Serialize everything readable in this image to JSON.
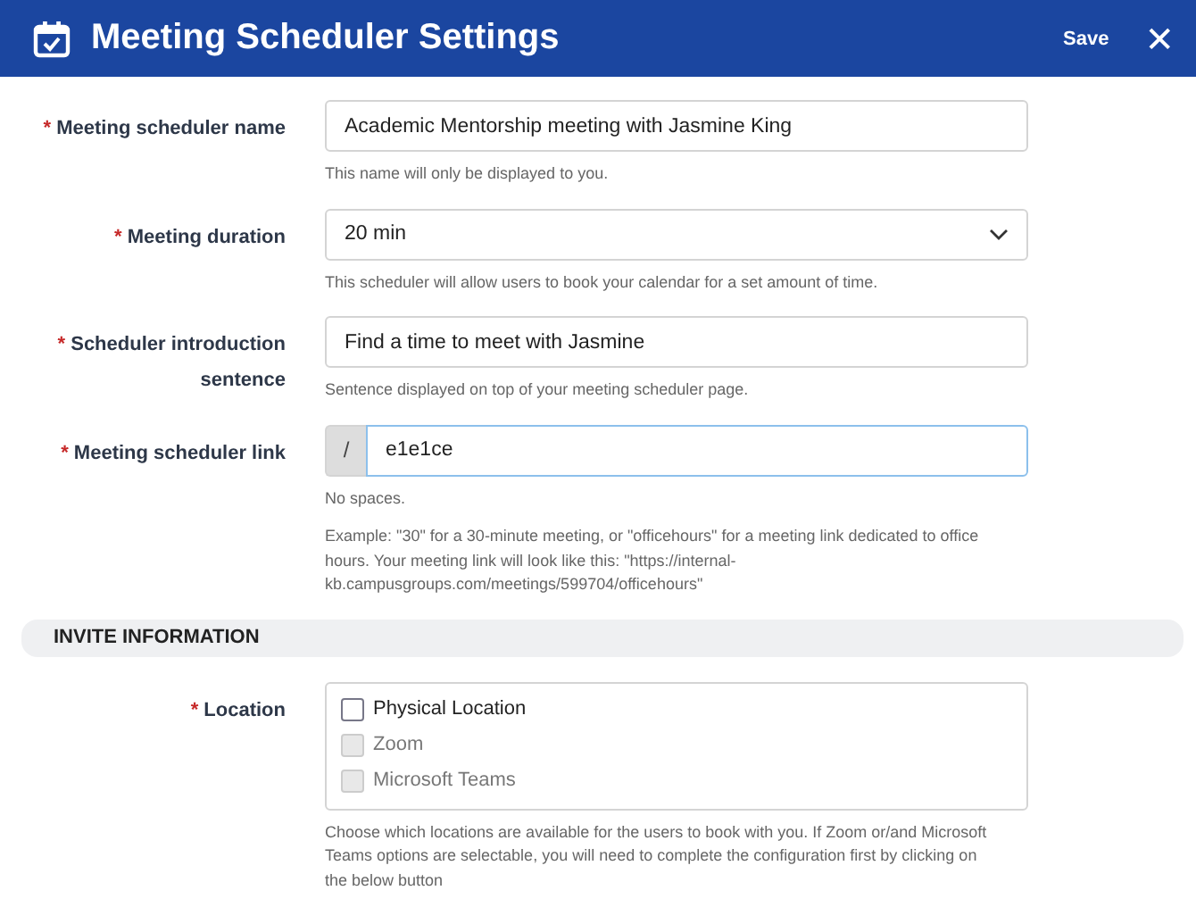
{
  "header": {
    "title": "Meeting Scheduler Settings",
    "save": "Save",
    "close": "✕"
  },
  "fields": [
    {
      "kind": "text",
      "required_mark": "*",
      "label": "Meeting scheduler name",
      "value": "Academic Mentorship meeting with Jasmine King",
      "focused": false,
      "help": [
        "This name will only be displayed to you."
      ]
    },
    {
      "kind": "select",
      "required_mark": "*",
      "label": "Meeting duration",
      "value": "20 min",
      "focused": false,
      "help": [
        "This scheduler will allow users to book your calendar for a set amount of time."
      ]
    },
    {
      "kind": "text",
      "required_mark": "*",
      "label": "Scheduler introduction sentence",
      "value": "Find a time to meet with Jasmine",
      "focused": false,
      "help": [
        "Sentence displayed on top of your meeting scheduler page."
      ]
    },
    {
      "kind": "prefixed",
      "required_mark": "*",
      "label": "Meeting scheduler link",
      "prefix": "/",
      "value": "e1e1ce",
      "focused": true,
      "help": [
        "No spaces.",
        "Example: \"30\" for a 30-minute meeting, or \"officehours\" for a meeting link dedicated to office hours. Your meeting link will look like this: \"https://internal-kb.campusgroups.com/meetings/599704/officehours\""
      ]
    }
  ],
  "section": {
    "title": "INVITE INFORMATION"
  },
  "location": {
    "required_mark": "*",
    "label": "Location",
    "options": [
      {
        "label": "Physical Location",
        "checked": false,
        "disabled": false
      },
      {
        "label": "Zoom",
        "checked": false,
        "disabled": true
      },
      {
        "label": "Microsoft Teams",
        "checked": false,
        "disabled": true
      }
    ],
    "help": "Choose which locations are available for the users to book with you. If Zoom or/and Microsoft Teams options are selectable, you will need to complete the configuration first by clicking on the below button"
  }
}
